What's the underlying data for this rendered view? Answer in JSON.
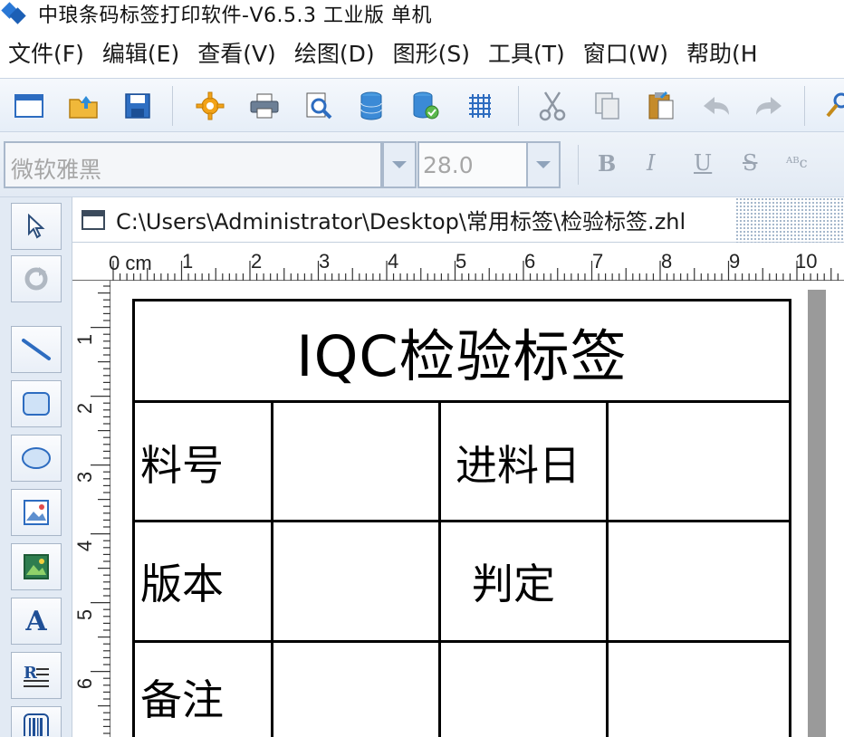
{
  "window": {
    "title": "中琅条码标签打印软件-V6.5.3 工业版 单机"
  },
  "menu": [
    "文件(F)",
    "编辑(E)",
    "查看(V)",
    "绘图(D)",
    "图形(S)",
    "工具(T)",
    "窗口(W)",
    "帮助(H"
  ],
  "toolbar": {
    "icons": [
      "new-icon",
      "open-icon",
      "save-icon",
      "settings-icon",
      "print-icon",
      "print-preview-icon",
      "database-icon",
      "database-setup-icon",
      "grid-icon",
      "cut-icon",
      "copy-icon",
      "paste-icon",
      "undo-icon",
      "redo-icon",
      "search-icon"
    ]
  },
  "format": {
    "font_placeholder": "微软雅黑",
    "size_placeholder": "28.0",
    "bold": "B",
    "italic": "I",
    "underline": "U",
    "strike": "S",
    "more": "ᴬᴮc"
  },
  "document": {
    "path": "C:\\Users\\Administrator\\Desktop\\常用标签\\检验标签.zhl"
  },
  "ruler": {
    "unit": "0 cm",
    "top": [
      "1",
      "2",
      "3",
      "4",
      "5",
      "6",
      "7",
      "8",
      "9",
      "10"
    ],
    "left": [
      "1",
      "2",
      "3",
      "4",
      "5",
      "6"
    ]
  },
  "label": {
    "title": "IQC检验标签",
    "cells": {
      "r1c1": "料号",
      "r1c3": "进料日",
      "r2c1": "版本",
      "r2c3": "判定",
      "r3c1": "备注"
    }
  },
  "colors": {
    "chrome": "#dfe8f3",
    "accent": "#2a78d6"
  }
}
